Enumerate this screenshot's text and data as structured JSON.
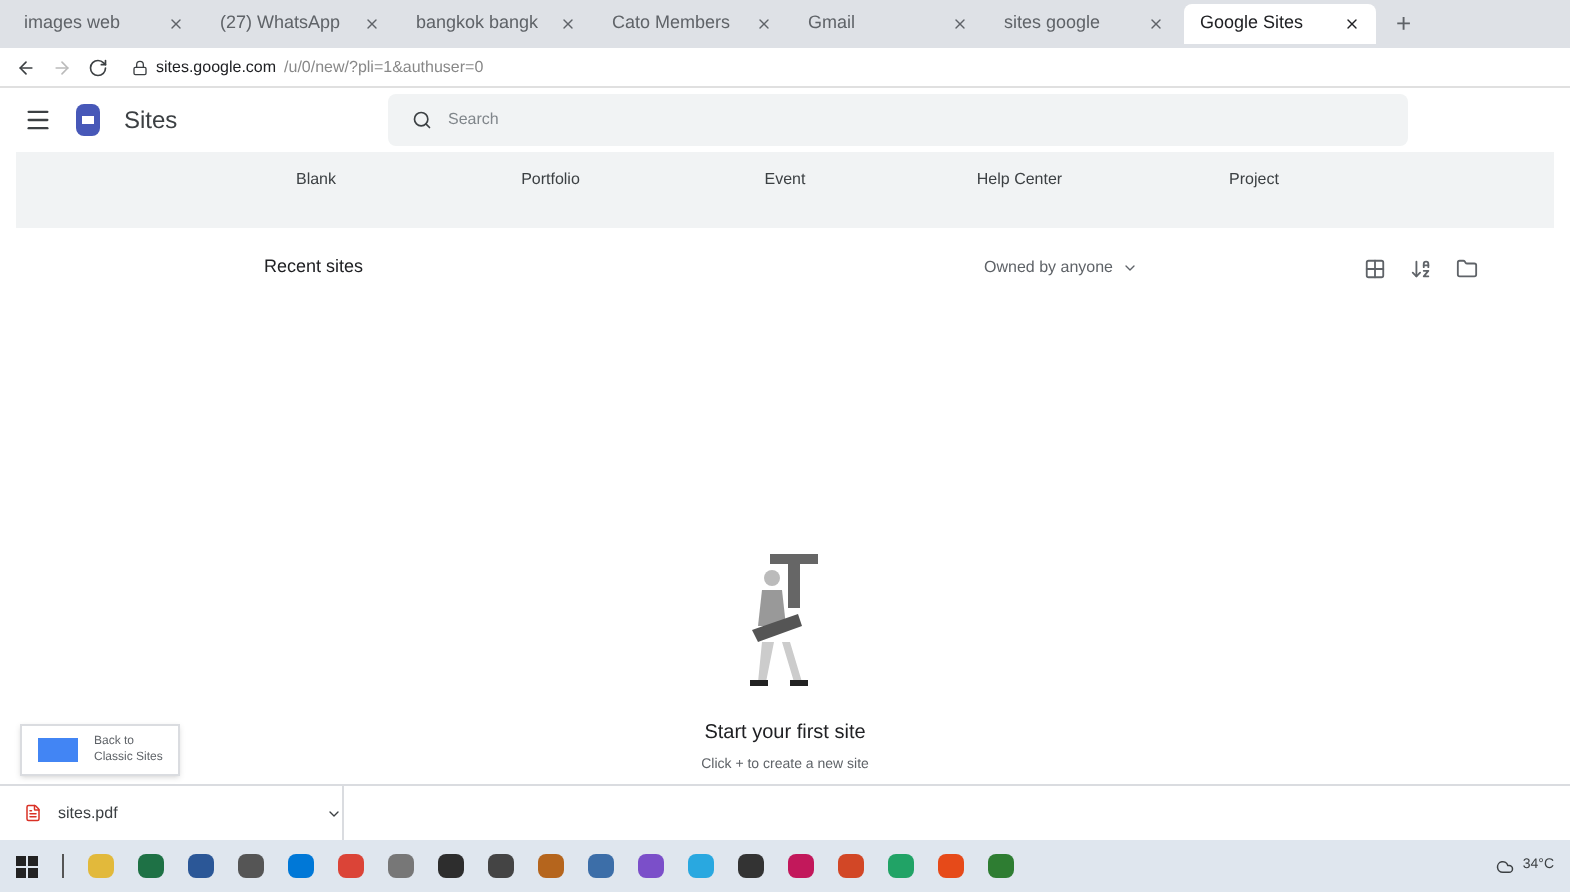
{
  "browser": {
    "tabs": [
      {
        "title": "images web",
        "selected": false
      },
      {
        "title": "(27) WhatsApp",
        "selected": false
      },
      {
        "title": "bangkok bangk",
        "selected": false
      },
      {
        "title": "Cato Members",
        "selected": false
      },
      {
        "title": "Gmail",
        "selected": false
      },
      {
        "title": "sites google",
        "selected": false
      },
      {
        "title": "Google Sites",
        "selected": true
      }
    ],
    "new_tab": "+",
    "url_host": "sites.google.com",
    "url_path": "/u/0/new/?pli=1&authuser=0"
  },
  "app": {
    "title": "Sites",
    "search": {
      "placeholder": "Search"
    }
  },
  "templates": [
    "Blank",
    "Portfolio",
    "Event",
    "Help Center",
    "Project"
  ],
  "recent": {
    "heading": "Recent sites",
    "owner_filter": "Owned by anyone"
  },
  "empty_state": {
    "title": "Start your first site",
    "hint": "Click + to create a new site"
  },
  "classic_button": {
    "line_1": "Back to",
    "line_2": "Classic Sites"
  },
  "download": {
    "file": "sites.pdf"
  },
  "taskbar": {
    "icons": [
      {
        "color": "#e2b93b"
      },
      {
        "color": "#1e7145"
      },
      {
        "color": "#2b5797"
      },
      {
        "color": "#555555"
      },
      {
        "color": "#0078d7"
      },
      {
        "color": "#db4437"
      },
      {
        "color": "#777777"
      },
      {
        "color": "#2d2d2d"
      },
      {
        "color": "#444444"
      },
      {
        "color": "#b5651d"
      },
      {
        "color": "#3c6ea8"
      },
      {
        "color": "#7b4fc9"
      },
      {
        "color": "#29a8e0"
      },
      {
        "color": "#333333"
      },
      {
        "color": "#c2185b"
      },
      {
        "color": "#d24726"
      },
      {
        "color": "#21a366"
      },
      {
        "color": "#e64a19"
      },
      {
        "color": "#2e7d32"
      }
    ],
    "weather": "34°C"
  }
}
